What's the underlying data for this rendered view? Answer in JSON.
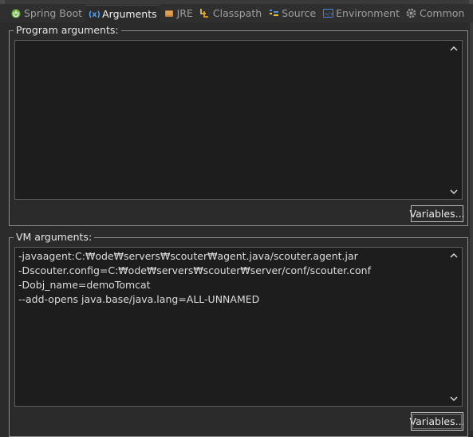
{
  "tabs": [
    {
      "label": "Spring Boot",
      "icon": "spring-boot-icon",
      "active": false
    },
    {
      "label": "Arguments",
      "icon": "arguments-icon",
      "active": true
    },
    {
      "label": "JRE",
      "icon": "jre-icon",
      "active": false
    },
    {
      "label": "Classpath",
      "icon": "classpath-icon",
      "active": false
    },
    {
      "label": "Source",
      "icon": "source-icon",
      "active": false
    },
    {
      "label": "Environment",
      "icon": "environment-icon",
      "active": false
    },
    {
      "label": "Common",
      "icon": "common-icon",
      "active": false
    }
  ],
  "program_arguments": {
    "title": "Program arguments:",
    "value": "",
    "variables_button": "Variables..."
  },
  "vm_arguments": {
    "title": "VM arguments:",
    "lines": [
      "-javaagent:C:₩ode₩servers₩scouter₩agent.java/scouter.agent.jar",
      "-Dscouter.config=C:₩ode₩servers₩scouter₩server/conf/scouter.conf",
      "-Dobj_name=demoTomcat",
      "--add-opens java.base/java.lang=ALL-UNNAMED"
    ],
    "variables_button": "Variables..."
  },
  "colors": {
    "background": "#2b2b2b",
    "textarea_bg": "#1d1d1d",
    "text": "#e6e6e6",
    "border": "#8e8e8e"
  }
}
